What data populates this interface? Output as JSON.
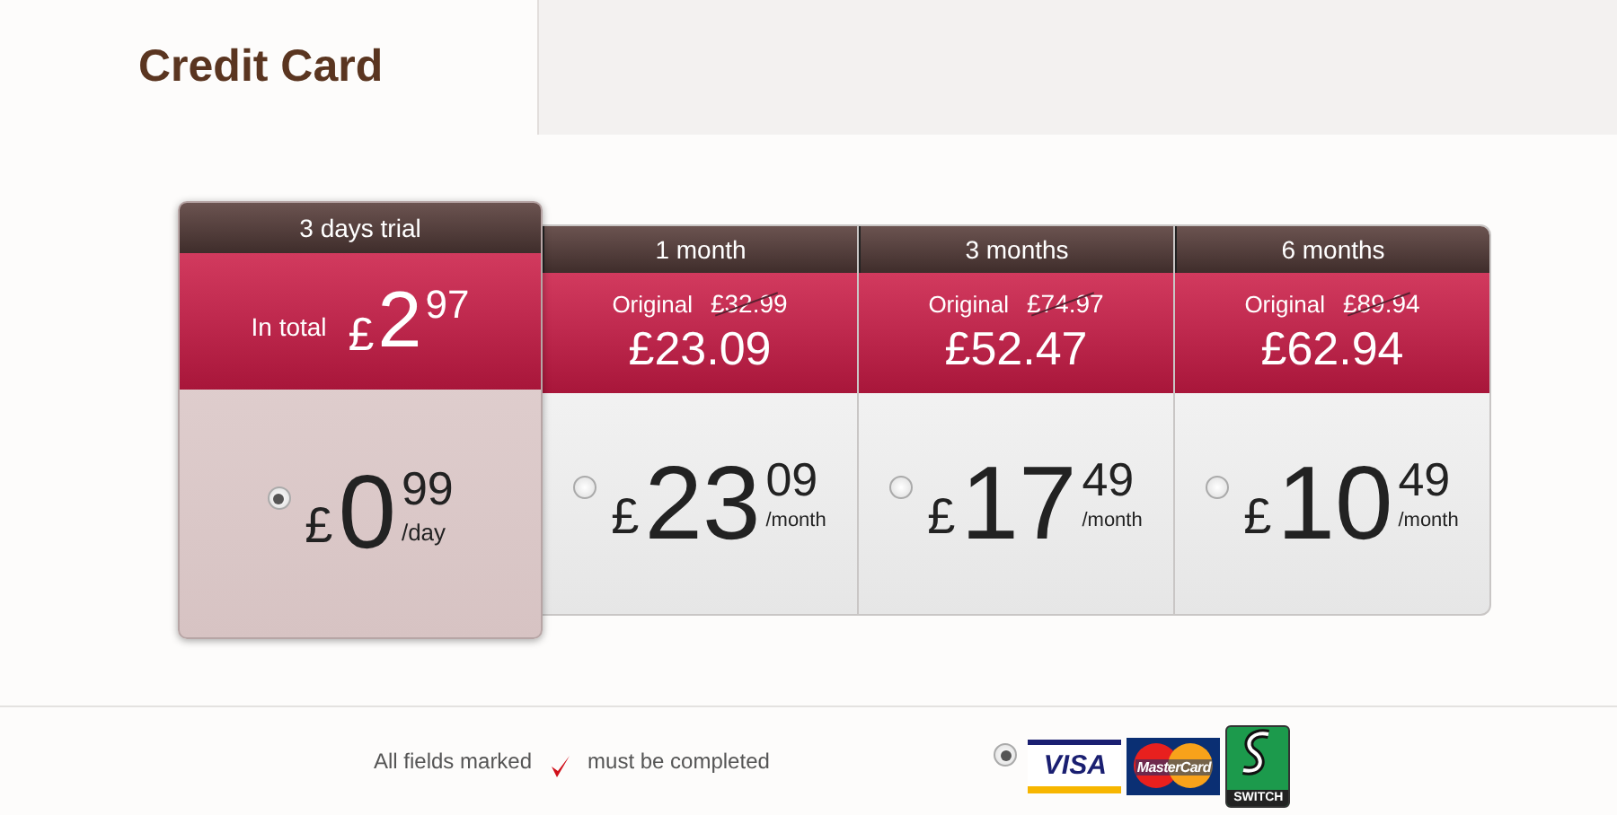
{
  "tab": {
    "label": "Credit Card"
  },
  "plans": [
    {
      "kind": "trial",
      "title": "3 days trial",
      "selected": true,
      "total_label": "In total",
      "total": {
        "currency": "£",
        "whole": "2",
        "cents": "97"
      },
      "price": {
        "currency": "£",
        "whole": "0",
        "cents": "99",
        "period": "/day"
      }
    },
    {
      "kind": "discount",
      "title": "1 month",
      "selected": false,
      "original_label": "Original",
      "original_price": "£32.99",
      "total": "£23.09",
      "price": {
        "currency": "£",
        "whole": "23",
        "cents": "09",
        "period": "/month"
      }
    },
    {
      "kind": "discount",
      "title": "3 months",
      "selected": false,
      "original_label": "Original",
      "original_price": "£74.97",
      "total": "£52.47",
      "price": {
        "currency": "£",
        "whole": "17",
        "cents": "49",
        "period": "/month"
      }
    },
    {
      "kind": "discount",
      "title": "6 months",
      "selected": false,
      "original_label": "Original",
      "original_price": "£89.94",
      "total": "£62.94",
      "price": {
        "currency": "£",
        "whole": "10",
        "cents": "49",
        "period": "/month"
      }
    }
  ],
  "footer": {
    "note_before": "All fields marked",
    "note_after": "must be completed",
    "card_option_selected": true,
    "card_logos": [
      "VISA",
      "MasterCard",
      "SWITCH"
    ]
  }
}
